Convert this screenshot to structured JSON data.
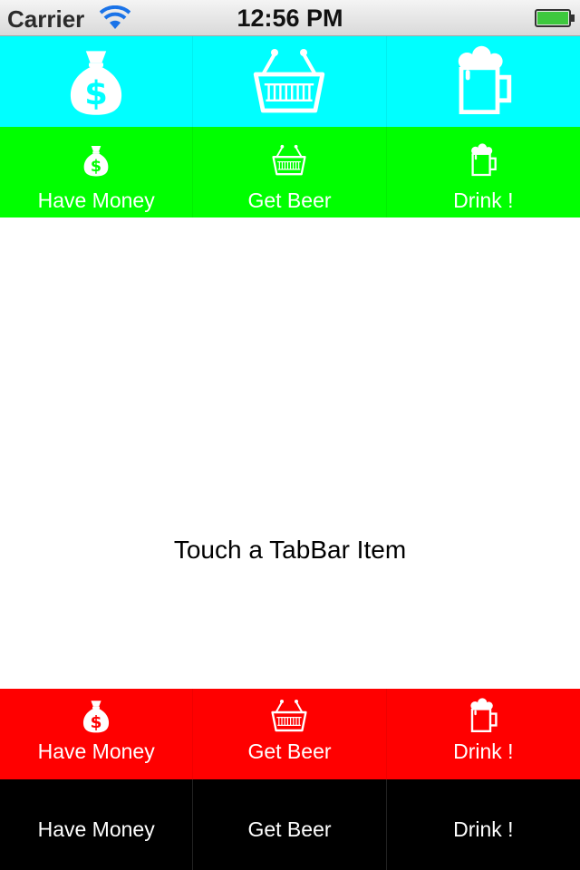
{
  "status_bar": {
    "carrier": "Carrier",
    "time": "12:56 PM",
    "battery_level": 1.0
  },
  "colors": {
    "icon_bar_bg": "#00ffff",
    "icon_label_bar_bg": "#00ff00",
    "red_bar_bg": "#ff0000",
    "text_bar_bg": "#000000",
    "content_bg": "#ffffff",
    "label_color": "#ffffff"
  },
  "tabbars": {
    "icons_only": {
      "items": [
        {
          "icon": "money-bag-icon"
        },
        {
          "icon": "basket-icon"
        },
        {
          "icon": "beer-mug-icon"
        }
      ]
    },
    "icons_and_labels": {
      "items": [
        {
          "icon": "money-bag-icon",
          "label": "Have Money"
        },
        {
          "icon": "basket-icon",
          "label": "Get Beer"
        },
        {
          "icon": "beer-mug-icon",
          "label": "Drink !"
        }
      ]
    },
    "red": {
      "items": [
        {
          "icon": "money-bag-icon",
          "label": "Have Money"
        },
        {
          "icon": "basket-icon",
          "label": "Get Beer"
        },
        {
          "icon": "beer-mug-icon",
          "label": "Drink !"
        }
      ]
    },
    "text_only": {
      "items": [
        {
          "label": "Have Money"
        },
        {
          "label": "Get Beer"
        },
        {
          "label": "Drink !"
        }
      ]
    }
  },
  "content": {
    "message": "Touch a TabBar Item"
  }
}
